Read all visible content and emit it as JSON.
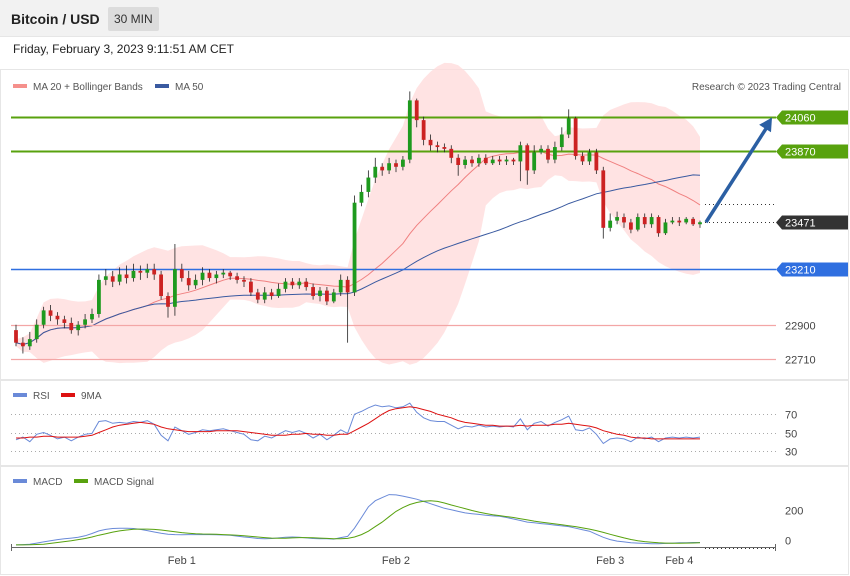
{
  "header": {
    "title": "Bitcoin / USD",
    "timeframe": "30 MIN",
    "datetime": "Friday, February 3, 2023 9:11:51 AM CET"
  },
  "legend": {
    "ma20": "MA 20 + Bollinger Bands",
    "ma50": "MA 50",
    "rsi": "RSI",
    "rsi_ma": "9MA",
    "macd": "MACD",
    "macd_signal": "MACD Signal",
    "credit": "Research © 2023 Trading Central"
  },
  "colors": {
    "up": "#1e9a1e",
    "down": "#cc2222",
    "bb": "#ffd9d9",
    "ma20": "#f08080",
    "ma50": "#3a5aa0",
    "resistance": "#58a20e",
    "support": "#2f6fe0",
    "level": "#f3a6a6",
    "last": "#333333",
    "arrow": "#2b5fa3"
  },
  "chart_data": [
    {
      "type": "candlestick",
      "title": "Bitcoin / USD",
      "timeframe": "30 MIN",
      "x_ticks": [
        "Feb 1",
        "Feb 2",
        "Feb 3",
        "Feb 4"
      ],
      "ylim": [
        22620,
        24180
      ],
      "levels": [
        {
          "label": "24060",
          "value": 24060,
          "kind": "resistance"
        },
        {
          "label": "23870",
          "value": 23870,
          "kind": "resistance"
        },
        {
          "label": "23471",
          "value": 23471,
          "kind": "last"
        },
        {
          "label": "23210",
          "value": 23210,
          "kind": "support"
        },
        {
          "label": "22900",
          "value": 22900,
          "kind": "level"
        },
        {
          "label": "22710",
          "value": 22710,
          "kind": "level"
        }
      ],
      "candles": [
        [
          22870,
          22800,
          22900,
          22780
        ],
        [
          22800,
          22780,
          22830,
          22740
        ],
        [
          22780,
          22820,
          22860,
          22760
        ],
        [
          22820,
          22900,
          22930,
          22800
        ],
        [
          22900,
          22980,
          23000,
          22880
        ],
        [
          22980,
          22950,
          23010,
          22920
        ],
        [
          22950,
          22930,
          22970,
          22900
        ],
        [
          22930,
          22910,
          22950,
          22880
        ],
        [
          22910,
          22870,
          22940,
          22850
        ],
        [
          22870,
          22900,
          22920,
          22840
        ],
        [
          22900,
          22930,
          22960,
          22880
        ],
        [
          22930,
          22960,
          22990,
          22910
        ],
        [
          22960,
          23150,
          23180,
          22940
        ],
        [
          23150,
          23170,
          23210,
          23120
        ],
        [
          23170,
          23140,
          23200,
          23110
        ],
        [
          23140,
          23180,
          23220,
          23120
        ],
        [
          23180,
          23160,
          23230,
          23130
        ],
        [
          23160,
          23200,
          23240,
          23140
        ],
        [
          23200,
          23190,
          23230,
          23150
        ],
        [
          23190,
          23210,
          23240,
          23160
        ],
        [
          23210,
          23180,
          23240,
          23150
        ],
        [
          23180,
          23060,
          23200,
          23040
        ],
        [
          23060,
          23000,
          23080,
          22940
        ],
        [
          23000,
          23210,
          23350,
          22950
        ],
        [
          23210,
          23160,
          23240,
          23140
        ],
        [
          23160,
          23120,
          23200,
          23090
        ],
        [
          23120,
          23150,
          23180,
          23100
        ],
        [
          23150,
          23190,
          23220,
          23120
        ],
        [
          23190,
          23160,
          23210,
          23140
        ],
        [
          23160,
          23180,
          23200,
          23130
        ],
        [
          23180,
          23190,
          23210,
          23160
        ],
        [
          23190,
          23170,
          23200,
          23150
        ],
        [
          23170,
          23150,
          23190,
          23130
        ],
        [
          23150,
          23140,
          23170,
          23110
        ],
        [
          23140,
          23080,
          23160,
          23060
        ],
        [
          23080,
          23040,
          23100,
          23020
        ],
        [
          23040,
          23080,
          23110,
          23020
        ],
        [
          23080,
          23060,
          23100,
          23040
        ],
        [
          23060,
          23100,
          23130,
          23050
        ],
        [
          23100,
          23140,
          23160,
          23080
        ],
        [
          23140,
          23120,
          23160,
          23100
        ],
        [
          23120,
          23140,
          23160,
          23100
        ],
        [
          23140,
          23110,
          23160,
          23090
        ],
        [
          23110,
          23060,
          23130,
          23040
        ],
        [
          23060,
          23090,
          23110,
          23030
        ],
        [
          23090,
          23030,
          23110,
          23010
        ],
        [
          23030,
          23080,
          23100,
          23020
        ],
        [
          23080,
          23150,
          23180,
          23060
        ],
        [
          23150,
          23080,
          23170,
          22800
        ],
        [
          23080,
          23580,
          23620,
          23060
        ],
        [
          23580,
          23640,
          23680,
          23560
        ],
        [
          23640,
          23720,
          23760,
          23610
        ],
        [
          23720,
          23780,
          23830,
          23690
        ],
        [
          23780,
          23760,
          23800,
          23730
        ],
        [
          23760,
          23800,
          23830,
          23740
        ],
        [
          23800,
          23780,
          23820,
          23750
        ],
        [
          23780,
          23820,
          23840,
          23760
        ],
        [
          23820,
          24150,
          24200,
          23800
        ],
        [
          24150,
          24040,
          24160,
          24000
        ],
        [
          24040,
          23930,
          24060,
          23900
        ],
        [
          23930,
          23900,
          23960,
          23870
        ],
        [
          23900,
          23890,
          23920,
          23860
        ],
        [
          23890,
          23880,
          23910,
          23860
        ],
        [
          23880,
          23830,
          23900,
          23800
        ],
        [
          23830,
          23790,
          23850,
          23730
        ],
        [
          23790,
          23820,
          23840,
          23770
        ],
        [
          23820,
          23800,
          23840,
          23780
        ],
        [
          23800,
          23830,
          23850,
          23780
        ],
        [
          23830,
          23800,
          23850,
          23790
        ],
        [
          23800,
          23820,
          23840,
          23790
        ],
        [
          23820,
          23810,
          23840,
          23790
        ],
        [
          23810,
          23820,
          23840,
          23790
        ],
        [
          23820,
          23810,
          23830,
          23790
        ],
        [
          23810,
          23900,
          23920,
          23700
        ],
        [
          23900,
          23760,
          23910,
          23680
        ],
        [
          23760,
          23860,
          23900,
          23740
        ],
        [
          23860,
          23880,
          23900,
          23850
        ],
        [
          23880,
          23820,
          23900,
          23800
        ],
        [
          23820,
          23890,
          23920,
          23800
        ],
        [
          23890,
          23960,
          24000,
          23870
        ],
        [
          23960,
          24050,
          24100,
          23940
        ],
        [
          24050,
          23840,
          24060,
          23820
        ],
        [
          23840,
          23810,
          23860,
          23790
        ],
        [
          23810,
          23860,
          23880,
          23790
        ],
        [
          23860,
          23760,
          23880,
          23740
        ],
        [
          23760,
          23440,
          23780,
          23380
        ],
        [
          23440,
          23480,
          23520,
          23420
        ],
        [
          23480,
          23500,
          23530,
          23460
        ],
        [
          23500,
          23470,
          23520,
          23440
        ],
        [
          23470,
          23430,
          23490,
          23410
        ],
        [
          23430,
          23500,
          23520,
          23420
        ],
        [
          23500,
          23460,
          23520,
          23440
        ],
        [
          23460,
          23500,
          23520,
          23440
        ],
        [
          23500,
          23410,
          23510,
          23390
        ],
        [
          23410,
          23470,
          23490,
          23400
        ],
        [
          23470,
          23480,
          23500,
          23460
        ],
        [
          23480,
          23470,
          23500,
          23450
        ],
        [
          23470,
          23490,
          23500,
          23460
        ],
        [
          23490,
          23460,
          23500,
          23450
        ],
        [
          23460,
          23471,
          23480,
          23440
        ]
      ],
      "arrow": {
        "from": 23471,
        "to": 24060
      }
    },
    {
      "type": "line",
      "title": "RSI",
      "y_ticks": [
        70,
        50,
        30
      ],
      "ylim": [
        20,
        80
      ],
      "series": [
        {
          "name": "RSI",
          "values": [
            42,
            45,
            40,
            48,
            50,
            47,
            43,
            45,
            41,
            45,
            48,
            49,
            62,
            63,
            60,
            61,
            60,
            62,
            61,
            63,
            59,
            47,
            41,
            56,
            52,
            48,
            50,
            53,
            52,
            53,
            54,
            52,
            50,
            48,
            42,
            41,
            46,
            44,
            48,
            52,
            50,
            52,
            49,
            44,
            48,
            42,
            47,
            53,
            49,
            70,
            73,
            77,
            80,
            78,
            79,
            77,
            78,
            82,
            72,
            66,
            63,
            62,
            62,
            58,
            54,
            57,
            56,
            58,
            56,
            57,
            56,
            57,
            56,
            65,
            53,
            60,
            62,
            57,
            61,
            64,
            68,
            53,
            52,
            55,
            48,
            38,
            43,
            44,
            43,
            40,
            45,
            43,
            45,
            40,
            44,
            45,
            44,
            45,
            44,
            45
          ]
        },
        {
          "name": "9MA",
          "values": [
            44,
            44,
            45,
            45,
            46,
            46,
            45,
            45,
            45,
            45,
            46,
            47,
            50,
            53,
            56,
            58,
            59,
            60,
            61,
            60,
            59,
            56,
            54,
            53,
            52,
            51,
            51,
            51,
            51,
            52,
            52,
            52,
            52,
            51,
            50,
            49,
            48,
            47,
            47,
            47,
            48,
            48,
            49,
            48,
            48,
            47,
            47,
            48,
            48,
            52,
            56,
            60,
            65,
            70,
            74,
            76,
            77,
            78,
            77,
            75,
            73,
            70,
            68,
            66,
            63,
            61,
            60,
            59,
            58,
            58,
            57,
            57,
            57,
            58,
            57,
            58,
            58,
            58,
            59,
            59,
            60,
            59,
            58,
            57,
            55,
            52,
            50,
            48,
            47,
            45,
            44,
            44,
            43,
            43,
            43,
            43,
            43,
            43,
            43,
            43
          ]
        }
      ]
    },
    {
      "type": "line",
      "title": "MACD",
      "y_ticks": [
        200,
        0
      ],
      "ylim": [
        -50,
        330
      ],
      "series": [
        {
          "name": "MACD",
          "values": [
            -30,
            -28,
            -25,
            -18,
            -10,
            -2,
            5,
            10,
            15,
            20,
            30,
            45,
            62,
            72,
            78,
            80,
            80,
            78,
            72,
            64,
            55,
            46,
            40,
            38,
            37,
            38,
            38,
            38,
            38,
            37,
            35,
            33,
            28,
            22,
            18,
            12,
            10,
            12,
            16,
            20,
            22,
            20,
            16,
            12,
            10,
            10,
            8,
            18,
            26,
            80,
            150,
            220,
            260,
            280,
            300,
            298,
            290,
            280,
            270,
            255,
            240,
            225,
            210,
            200,
            190,
            180,
            175,
            170,
            165,
            160,
            158,
            150,
            140,
            130,
            120,
            115,
            110,
            105,
            100,
            95,
            90,
            80,
            70,
            60,
            40,
            20,
            5,
            -5,
            -10,
            -15,
            -18,
            -20,
            -22,
            -22,
            -20,
            -18,
            -16,
            -15,
            -14,
            -14
          ]
        },
        {
          "name": "MACD Signal",
          "values": [
            -30,
            -30,
            -29,
            -27,
            -25,
            -20,
            -14,
            -8,
            -2,
            5,
            12,
            22,
            34,
            44,
            54,
            62,
            68,
            73,
            74,
            74,
            72,
            68,
            62,
            56,
            51,
            47,
            44,
            42,
            41,
            40,
            38,
            36,
            34,
            30,
            26,
            22,
            18,
            15,
            14,
            14,
            16,
            18,
            18,
            17,
            15,
            13,
            11,
            11,
            13,
            22,
            38,
            60,
            90,
            120,
            155,
            190,
            215,
            235,
            248,
            256,
            260,
            255,
            245,
            232,
            220,
            208,
            196,
            185,
            176,
            168,
            162,
            156,
            150,
            142,
            134,
            126,
            120,
            114,
            108,
            102,
            96,
            90,
            82,
            74,
            64,
            52,
            40,
            28,
            16,
            6,
            -2,
            -8,
            -12,
            -16,
            -18,
            -19,
            -19,
            -18,
            -17,
            -16
          ]
        }
      ]
    }
  ]
}
